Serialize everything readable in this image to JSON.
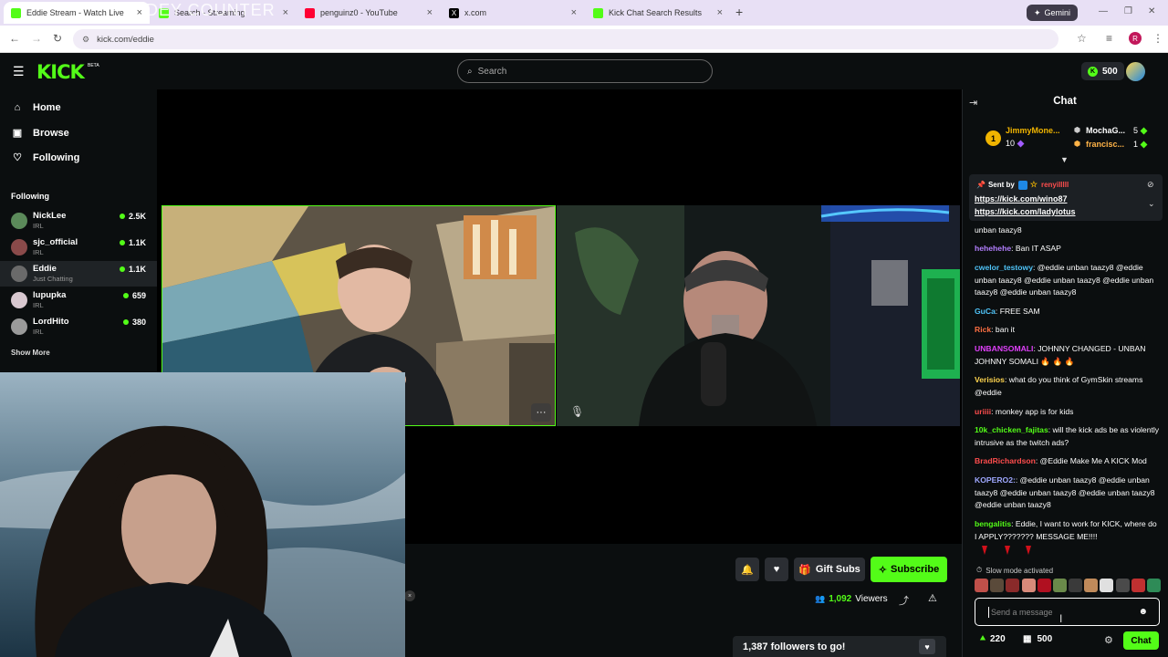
{
  "browser": {
    "overlay_text": "DEY COUNTER",
    "tabs": [
      {
        "label": "Eddie Stream - Watch Live",
        "color": "#53fc18"
      },
      {
        "label": "Search - Streaming",
        "color": "#53fc18"
      },
      {
        "label": "penguinz0 - YouTube",
        "color": "#ff0033"
      },
      {
        "label": "x.com",
        "color": "#000000"
      },
      {
        "label": "Kick Chat Search Results",
        "color": "#53fc18"
      }
    ],
    "new_tab": "+",
    "gemini_label": "Gemini",
    "url": "kick.com/eddie"
  },
  "kick": {
    "logo": "KICK",
    "beta": "BETA",
    "search_placeholder": "Search",
    "points": "500"
  },
  "sidebar": {
    "nav": [
      {
        "label": "Home",
        "icon": "home-icon"
      },
      {
        "label": "Browse",
        "icon": "browse-icon"
      },
      {
        "label": "Following",
        "icon": "heart-icon"
      }
    ],
    "following_title": "Following",
    "channels": [
      {
        "name": "NickLee",
        "category": "IRL",
        "viewers": "2.5K",
        "avatar": "#5b8a5a"
      },
      {
        "name": "sjc_official",
        "category": "IRL",
        "viewers": "1.1K",
        "avatar": "#8a4a4a"
      },
      {
        "name": "Eddie",
        "category": "Just Chatting",
        "viewers": "1.1K",
        "avatar": "#6a6a6a"
      },
      {
        "name": "lupupka",
        "category": "IRL",
        "viewers": "659",
        "avatar": "#d8c8d0"
      },
      {
        "name": "LordHito",
        "category": "IRL",
        "viewers": "380",
        "avatar": "#9a9a9a"
      }
    ],
    "show_more": "Show More"
  },
  "player": {
    "more_label": "···",
    "close_x": "×"
  },
  "stream": {
    "gift_subs": "Gift Subs",
    "subscribe": "Subscribe",
    "viewers_count": "1,092",
    "viewers_label": "Viewers",
    "goal_text": "1,387 followers to go!"
  },
  "chat": {
    "title": "Chat",
    "leaderboard": [
      {
        "rank": "1",
        "name": "JimmyMone...",
        "count": "10",
        "color": "#f0b400"
      },
      {
        "name": "MochaG...",
        "count": "5",
        "color": "#ffffff"
      },
      {
        "name": "francisc...",
        "count": "1",
        "color": "#ffb347"
      }
    ],
    "pinned": {
      "sent_by": "Sent by",
      "sender": "renyilllll",
      "links": [
        "https://kick.com/wino87",
        "https://kick.com/ladylotus"
      ]
    },
    "messages": [
      {
        "user": "",
        "color": "#ffffff",
        "text": "unban taazy8"
      },
      {
        "user": "hehehehe",
        "color": "#b37fff",
        "text": ": Ban IT ASAP"
      },
      {
        "user": "cwelor_testowy",
        "color": "#4fc3f7",
        "text": ": @eddie unban taazy8 @eddie unban taazy8 @eddie unban taazy8 @eddie unban taazy8 @eddie unban taazy8"
      },
      {
        "user": "GuCa",
        "color": "#4fc3f7",
        "text": ": FREE SAM"
      },
      {
        "user": "Rick",
        "color": "#ff7043",
        "text": ": ban it"
      },
      {
        "user": "UNBANSOMALI",
        "color": "#e040fb",
        "text": ": JOHNNY CHANGED - UNBAN JOHNNY SOMALI 🔥 🔥 🔥"
      },
      {
        "user": "Verisios",
        "color": "#ffd54f",
        "text": ": what do you think of GymSkin streams @eddie"
      },
      {
        "user": "uriiii",
        "color": "#ff4d4d",
        "text": ": monkey app is for kids"
      },
      {
        "user": "10k_chicken_fajitas",
        "color": "#53fc18",
        "text": ": will the kick ads be as violently intrusive as the twitch ads?"
      },
      {
        "user": "BradRichardson",
        "color": "#ff4d4d",
        "text": ": @Eddie Make Me A KICK Mod"
      },
      {
        "user": "KOPERO2:",
        "color": "#9fa8ff",
        "text": ": @eddie unban taazy8 @eddie unban taazy8 @eddie unban taazy8 @eddie unban taazy8 @eddie unban taazy8"
      },
      {
        "user": "bengalitis",
        "color": "#53fc18",
        "text": ":      Eddie, I want to work for KICK, where do I APPLY??????? MESSAGE ME!!!!"
      }
    ],
    "slow_mode": "Slow mode activated",
    "input_placeholder": "Send a message",
    "footer_points": "220",
    "footer_kicks": "500",
    "chat_button": "Chat"
  }
}
